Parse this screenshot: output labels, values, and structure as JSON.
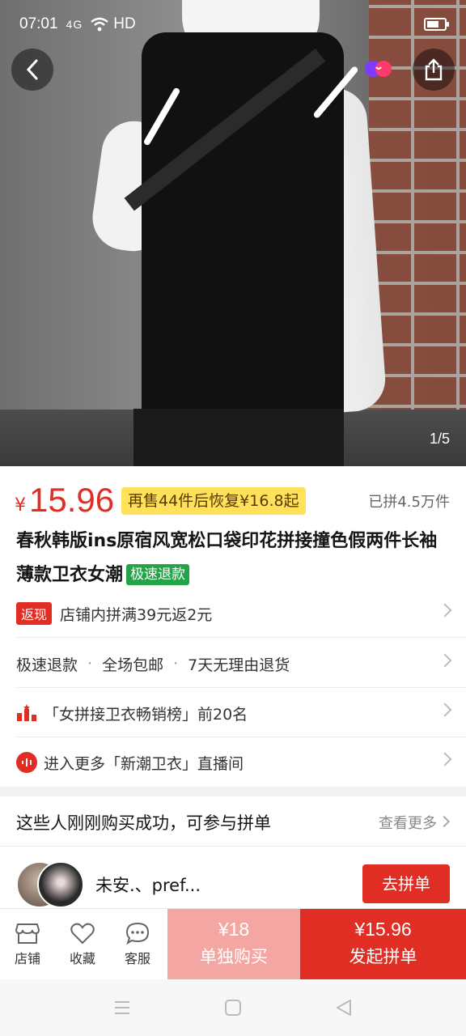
{
  "status_bar": {
    "time": "07:01",
    "signal": "4G",
    "network": "HD"
  },
  "gallery": {
    "page_indicator": "1/5"
  },
  "product": {
    "price_symbol": "¥",
    "price": "15.96",
    "promo": "再售44件后恢复¥16.8起",
    "sold": "已拼4.5万件",
    "title": "春秋韩版ins原宿风宽松口袋印花拼接撞色假两件长袖薄款卫衣女潮",
    "title_tag": "极速退款"
  },
  "rows": {
    "cashback_badge": "返现",
    "cashback_text": "店铺内拼满39元返2元",
    "service_1": "极速退款",
    "service_2": "全场包邮",
    "service_3": "7天无理由退货",
    "rank_text": "「女拼接卫衣畅销榜」前20名",
    "live_text": "进入更多「新潮卫衣」直播间"
  },
  "group": {
    "heading": "这些人刚刚购买成功，可参与拼单",
    "more": "查看更多",
    "user_name": "未安.、pref...",
    "join_label": "去拼单"
  },
  "bottom_bar": {
    "shop": "店铺",
    "favorite": "收藏",
    "service": "客服",
    "alone_price": "¥18",
    "alone_label": "单独购买",
    "group_price": "¥15.96",
    "group_label": "发起拼单"
  },
  "colors": {
    "accent": "#e02e24",
    "promo_bg": "#ffe15a",
    "tag_green": "#25a348",
    "alone_bg": "#f4a6a2"
  }
}
